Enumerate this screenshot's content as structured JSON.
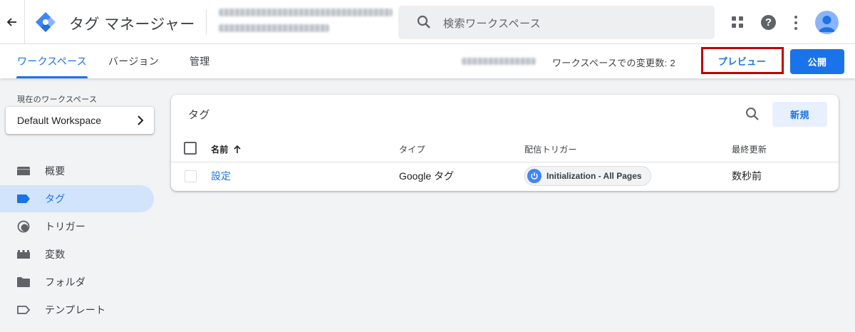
{
  "header": {
    "app_title": "タグ マネージャー",
    "search_placeholder": "検索ワークスペース"
  },
  "subnav": {
    "tabs": [
      {
        "label": "ワークスペース"
      },
      {
        "label": "バージョン"
      },
      {
        "label": "管理"
      }
    ],
    "changes_text": "ワークスペースでの変更数: 2",
    "preview_label": "プレビュー",
    "publish_label": "公開"
  },
  "sidebar": {
    "workspace_caption": "現在のワークスペース",
    "workspace_name": "Default Workspace",
    "items": [
      {
        "label": "概要",
        "icon": "overview-icon"
      },
      {
        "label": "タグ",
        "icon": "tag-icon"
      },
      {
        "label": "トリガー",
        "icon": "trigger-icon"
      },
      {
        "label": "変数",
        "icon": "variables-icon"
      },
      {
        "label": "フォルダ",
        "icon": "folder-icon"
      },
      {
        "label": "テンプレート",
        "icon": "template-icon"
      }
    ],
    "active_index": 1
  },
  "card": {
    "title": "タグ",
    "new_label": "新規",
    "columns": {
      "name": "名前",
      "type": "タイプ",
      "trigger": "配信トリガー",
      "updated": "最終更新"
    },
    "rows": [
      {
        "name": "設定",
        "type": "Google タグ",
        "trigger": "Initialization - All Pages",
        "updated": "数秒前"
      }
    ]
  },
  "colors": {
    "accent": "#1a73e8",
    "highlight_box": "#c00000",
    "active_nav_bg": "#d2e3fc",
    "page_bg": "#f1f3f4"
  }
}
